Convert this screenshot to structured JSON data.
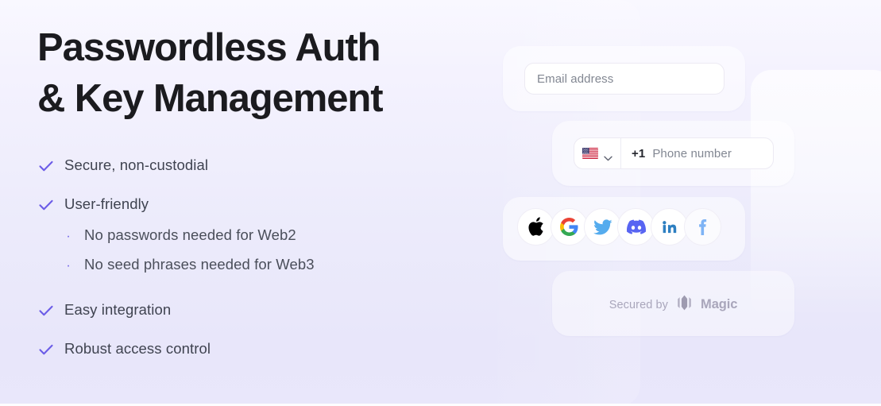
{
  "theme": {
    "bg_top": "#f9f8ff",
    "bg_bottom": "#e8e6fa",
    "accent": "#6b5ce7",
    "heading_color": "#1b1b1f",
    "body_text_color": "#3f4350",
    "placeholder_color": "#828792",
    "muted_color": "#a9a6bb"
  },
  "hero": {
    "headline_line_1": "Passwordless Auth",
    "headline_line_2": "& Key Management",
    "features": [
      {
        "label": "Secure, non-custodial",
        "icon": "check-icon",
        "sub_items": []
      },
      {
        "label": "User-friendly",
        "icon": "check-icon",
        "sub_items": [
          {
            "bullet": "·",
            "label": "No passwords needed for Web2"
          },
          {
            "bullet": "·",
            "label": "No seed phrases needed for Web3"
          }
        ]
      },
      {
        "label": "Easy integration",
        "icon": "check-icon",
        "sub_items": []
      },
      {
        "label": "Robust access control",
        "icon": "check-icon",
        "sub_items": []
      }
    ]
  },
  "widget": {
    "email_card": {
      "input_value": "",
      "placeholder": "Email address"
    },
    "phone_card": {
      "country_flag": "us-flag-icon",
      "country_chevron": "chevron-down-icon",
      "dial_code": "+1",
      "input_value": "",
      "placeholder": "Phone number"
    },
    "social_card": {
      "providers": [
        {
          "name": "apple",
          "icon": "apple-icon",
          "color": "#000000"
        },
        {
          "name": "google",
          "icon": "google-icon",
          "color": "#4285f4"
        },
        {
          "name": "twitter",
          "icon": "twitter-icon",
          "color": "#55acee"
        },
        {
          "name": "discord",
          "icon": "discord-icon",
          "color": "#5865f2"
        },
        {
          "name": "linkedin",
          "icon": "linkedin-icon",
          "color": "#2d7fc1"
        },
        {
          "name": "facebook",
          "icon": "facebook-icon",
          "color": "#7eb3f5"
        }
      ]
    },
    "footer_card": {
      "secured_by_text": "Secured by",
      "brand_name": "Magic",
      "brand_mark": "magic-logo-icon"
    }
  }
}
